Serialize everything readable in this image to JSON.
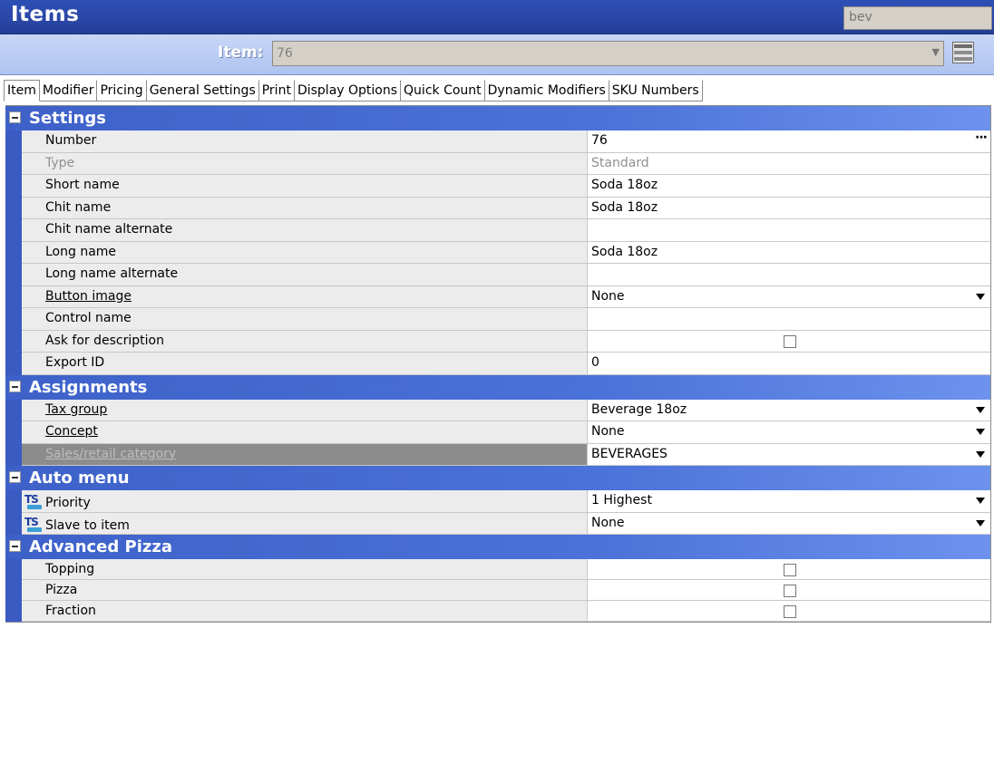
{
  "window": {
    "title": "Items",
    "search_value": "bev"
  },
  "item_selector": {
    "label": "Item:",
    "value": "76"
  },
  "tabs": [
    "Item",
    "Modifier",
    "Pricing",
    "General Settings",
    "Print",
    "Display Options",
    "Quick Count",
    "Dynamic Modifiers",
    "SKU Numbers"
  ],
  "active_tab": "Item",
  "sections": {
    "settings": {
      "name": "Settings",
      "rows": [
        {
          "label": "Number",
          "value": "76"
        },
        {
          "label": "Type",
          "value": "Standard"
        },
        {
          "label": "Short name",
          "value": "Soda 18oz"
        },
        {
          "label": "Chit name",
          "value": "Soda 18oz"
        },
        {
          "label": "Chit name alternate",
          "value": ""
        },
        {
          "label": "Long name",
          "value": "Soda 18oz"
        },
        {
          "label": "Long name alternate",
          "value": ""
        },
        {
          "label": "Button image",
          "value": "None"
        },
        {
          "label": "Control name",
          "value": ""
        },
        {
          "label": "Ask for description",
          "checked": false
        },
        {
          "label": "Export ID",
          "value": "0"
        }
      ]
    },
    "assignments": {
      "name": "Assignments",
      "rows": [
        {
          "label": "Tax group",
          "value": "Beverage 18oz"
        },
        {
          "label": "Concept",
          "value": "None"
        },
        {
          "label": "Sales/retail category",
          "value": "BEVERAGES"
        }
      ]
    },
    "auto_menu": {
      "name": "Auto menu",
      "rows": [
        {
          "label": "Priority",
          "value": "1 Highest"
        },
        {
          "label": "Slave to item",
          "value": "None"
        }
      ]
    },
    "advanced_pizza": {
      "name": "Advanced Pizza",
      "rows": [
        {
          "label": "Topping",
          "checked": false
        },
        {
          "label": "Pizza",
          "checked": false
        },
        {
          "label": "Fraction",
          "checked": false
        }
      ]
    }
  },
  "icons": {
    "ts_icon_text": "TS"
  },
  "colors": {
    "title_bar": "#2a47a6",
    "section_header": "#4a72d8",
    "item_bar": "#b7c9f1"
  }
}
